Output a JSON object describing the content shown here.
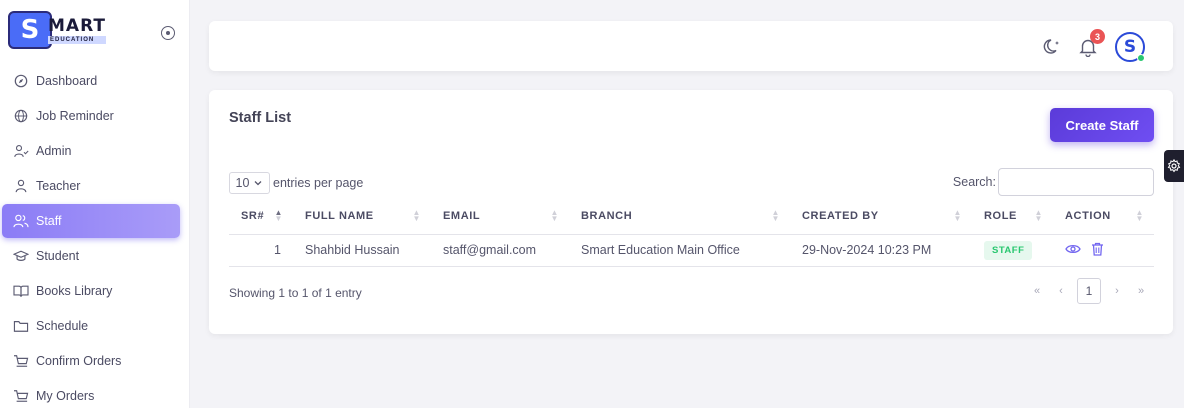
{
  "brand": {
    "main": "MART",
    "sub": "EDUCATION",
    "logo_letter": "S"
  },
  "sidebar": {
    "items": [
      {
        "label": "Dashboard",
        "icon": "compass-icon"
      },
      {
        "label": "Job Reminder",
        "icon": "globe-icon"
      },
      {
        "label": "Admin",
        "icon": "user-check-icon"
      },
      {
        "label": "Teacher",
        "icon": "user-icon"
      },
      {
        "label": "Staff",
        "icon": "users-icon",
        "active": true
      },
      {
        "label": "Student",
        "icon": "graduation-cap-icon"
      },
      {
        "label": "Books Library",
        "icon": "book-open-icon"
      },
      {
        "label": "Schedule",
        "icon": "folder-icon"
      },
      {
        "label": "Confirm Orders",
        "icon": "cart-icon"
      },
      {
        "label": "My Orders",
        "icon": "cart-icon"
      }
    ]
  },
  "topbar": {
    "notification_count": "3",
    "avatar_letter": "S"
  },
  "card": {
    "title": "Staff List",
    "create_button": "Create Staff",
    "entries_value": "10",
    "entries_label": "entries per page",
    "search_label": "Search:",
    "search_value": "",
    "columns": [
      "SR#",
      "FULL NAME",
      "EMAIL",
      "BRANCH",
      "CREATED BY",
      "ROLE",
      "ACTION"
    ],
    "rows": [
      {
        "sr": "1",
        "full_name": "Shahbid Hussain",
        "email": "staff@gmail.com",
        "branch": "Smart Education Main Office",
        "created_by": "29-Nov-2024 10:23 PM",
        "role": "STAFF"
      }
    ],
    "showing": "Showing 1 to 1 of 1 entry",
    "pagination": {
      "first": "«",
      "prev": "‹",
      "current": "1",
      "next": "›",
      "last": "»"
    }
  },
  "colors": {
    "accent": "#7367f0",
    "button": "#5f3fe0",
    "badge": "#ea5455",
    "role_badge_text": "#28c76f",
    "role_badge_bg": "#e6f8ee"
  }
}
